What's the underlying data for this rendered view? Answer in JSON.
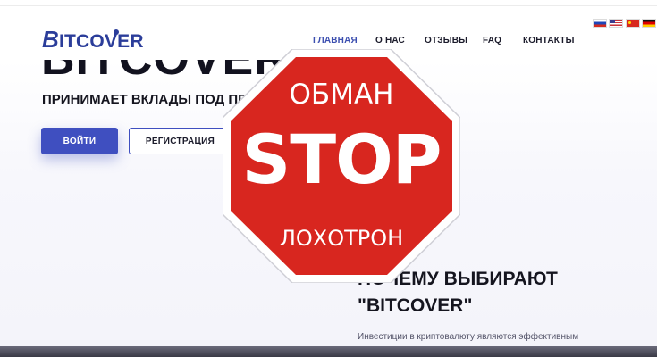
{
  "brand": {
    "logo_initial": "B",
    "logo_rest": "ITCOVER",
    "accent_color": "#3f4fc0"
  },
  "nav": {
    "items": [
      {
        "label": "ГЛАВНАЯ",
        "active": true
      },
      {
        "label": "О НАС",
        "active": false
      },
      {
        "label": "ОТЗЫВЫ",
        "active": false
      },
      {
        "label": "FAQ",
        "active": false
      },
      {
        "label": "КОНТАКТЫ",
        "active": false
      }
    ]
  },
  "languages": [
    "russia-flag-icon",
    "usa-flag-icon",
    "china-flag-icon",
    "germany-flag-icon"
  ],
  "hero": {
    "title": "BITCOVER",
    "subtitle": "ПРИНИМАЕТ ВКЛАДЫ ПОД ПРО",
    "login_label": "ВОЙТИ",
    "register_label": "РЕГИСТРАЦИЯ"
  },
  "why": {
    "title_line1": "ПОЧЕМУ ВЫБИРАЮТ",
    "title_line2": "\"BITCOVER\"",
    "text": "Инвестиции в криптовалюту являются эффективным"
  },
  "stop_sign": {
    "top_text": "ОБМАН",
    "main_text": "STOP",
    "bottom_text": "ЛОХОТРОН",
    "fill_color": "#d8261f",
    "border_color": "#ffffff"
  }
}
